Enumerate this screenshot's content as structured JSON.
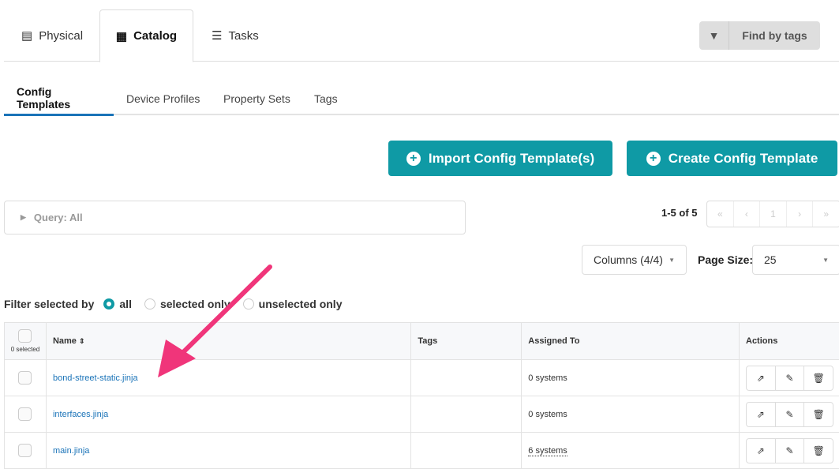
{
  "top_tabs": [
    {
      "label": "Physical",
      "icon": "server-icon"
    },
    {
      "label": "Catalog",
      "icon": "list-icon",
      "active": true
    },
    {
      "label": "Tasks",
      "icon": "tasks-icon"
    }
  ],
  "find_by_tags": "Find by tags",
  "sub_tabs": [
    {
      "label": "Config Templates",
      "active": true
    },
    {
      "label": "Device Profiles"
    },
    {
      "label": "Property Sets"
    },
    {
      "label": "Tags"
    }
  ],
  "buttons": {
    "import": "Import Config Template(s)",
    "create": "Create Config Template"
  },
  "query": "Query: All",
  "pagination": {
    "summary": "1-5 of 5",
    "first": "«",
    "prev": "‹",
    "page": "1",
    "next": "›",
    "last": "»"
  },
  "columns_select": "Columns (4/4)",
  "page_size": {
    "label": "Page Size:",
    "value": "25"
  },
  "filter": {
    "label": "Filter selected by",
    "options": [
      "all",
      "selected only",
      "unselected only"
    ],
    "selected": "all"
  },
  "table": {
    "selected_count": "0 selected",
    "headers": [
      "Name",
      "Tags",
      "Assigned To",
      "Actions"
    ],
    "rows": [
      {
        "name": "bond-street-static.jinja",
        "tags": "",
        "assigned": "0 systems"
      },
      {
        "name": "interfaces.jinja",
        "tags": "",
        "assigned": "0 systems"
      },
      {
        "name": "main.jinja",
        "tags": "",
        "assigned": "6 systems"
      }
    ]
  },
  "colors": {
    "accent": "#0f9aa5",
    "link": "#1a73b8",
    "arrow": "#f0357a"
  }
}
